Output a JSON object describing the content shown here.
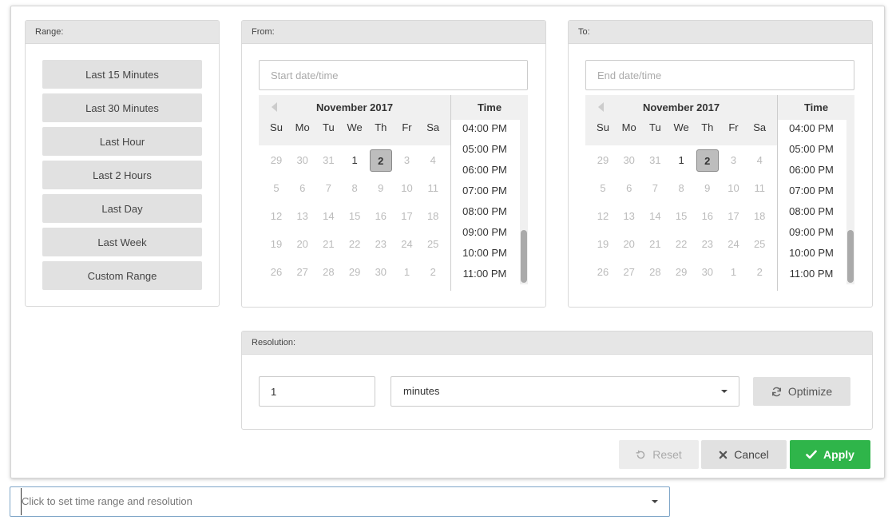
{
  "range": {
    "title": "Range:",
    "options": [
      "Last 15 Minutes",
      "Last 30 Minutes",
      "Last Hour",
      "Last 2 Hours",
      "Last Day",
      "Last Week",
      "Custom Range"
    ]
  },
  "from": {
    "title": "From:",
    "placeholder": "Start date/time",
    "month": "November 2017",
    "time_header": "Time"
  },
  "to": {
    "title": "To:",
    "placeholder": "End date/time",
    "month": "November 2017",
    "time_header": "Time"
  },
  "calendar": {
    "weekdays": [
      "Su",
      "Mo",
      "Tu",
      "We",
      "Th",
      "Fr",
      "Sa"
    ],
    "weeks": [
      [
        "29",
        "30",
        "31",
        "1",
        "2",
        "3",
        "4"
      ],
      [
        "5",
        "6",
        "7",
        "8",
        "9",
        "10",
        "11"
      ],
      [
        "12",
        "13",
        "14",
        "15",
        "16",
        "17",
        "18"
      ],
      [
        "19",
        "20",
        "21",
        "22",
        "23",
        "24",
        "25"
      ],
      [
        "26",
        "27",
        "28",
        "29",
        "30",
        "1",
        "2"
      ]
    ],
    "current_days": [
      "1",
      "2"
    ],
    "selected_day": "2",
    "times": [
      "04:00 PM",
      "05:00 PM",
      "06:00 PM",
      "07:00 PM",
      "08:00 PM",
      "09:00 PM",
      "10:00 PM",
      "11:00 PM"
    ]
  },
  "resolution": {
    "title": "Resolution:",
    "value": "1",
    "unit": "minutes",
    "optimize_label": "Optimize"
  },
  "actions": {
    "reset_label": "Reset",
    "cancel_label": "Cancel",
    "apply_label": "Apply"
  },
  "bottom": {
    "placeholder": "Click to set time range and resolution"
  },
  "colors": {
    "apply": "#2fb54a",
    "button_gray": "#e1e1e1",
    "header_gray": "#e6e6e6"
  }
}
